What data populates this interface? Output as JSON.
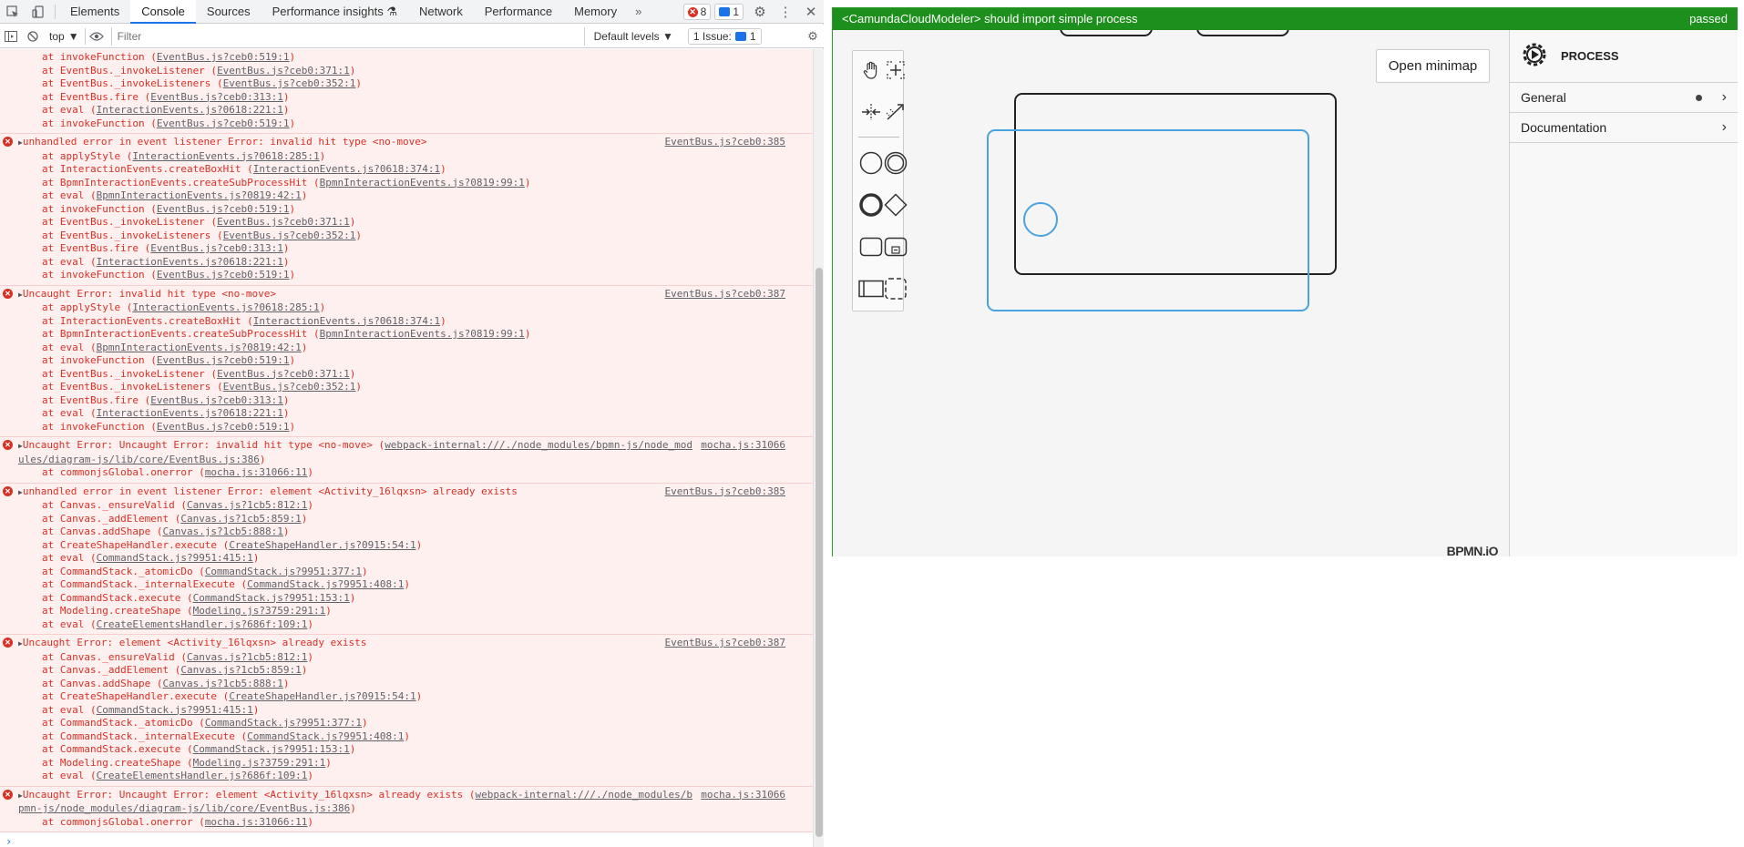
{
  "devtools": {
    "tabs": [
      "Elements",
      "Console",
      "Sources",
      "Performance insights",
      "Network",
      "Performance",
      "Memory"
    ],
    "more_tabs": "»",
    "error_count": "8",
    "message_count": "1",
    "context": "top",
    "filter_placeholder": "Filter",
    "levels": "Default levels",
    "issues": "1 Issue:",
    "issues_count": "1"
  },
  "console": {
    "partial": [
      {
        "text": "at invokeFunction (",
        "link": "EventBus.js?ceb0:519:1",
        "end": ")"
      },
      {
        "text": "at EventBus._invokeListener (",
        "link": "EventBus.js?ceb0:371:1",
        "end": ")"
      },
      {
        "text": "at EventBus._invokeListeners (",
        "link": "EventBus.js?ceb0:352:1",
        "end": ")"
      },
      {
        "text": "at EventBus.fire (",
        "link": "EventBus.js?ceb0:313:1",
        "end": ")"
      },
      {
        "text": "at eval (",
        "link": "InteractionEvents.js?0618:221:1",
        "end": ")"
      },
      {
        "text": "at invokeFunction (",
        "link": "EventBus.js?ceb0:519:1",
        "end": ")"
      }
    ],
    "entry1": {
      "head": "unhandled error in event listener Error: invalid hit type <no-move>",
      "src": "EventBus.js?ceb0:385",
      "lines": [
        {
          "text": "at applyStyle (",
          "link": "InteractionEvents.js?0618:285:1",
          "end": ")"
        },
        {
          "text": "at InteractionEvents.createBoxHit (",
          "link": "InteractionEvents.js?0618:374:1",
          "end": ")"
        },
        {
          "text": "at BpmnInteractionEvents.createSubProcessHit (",
          "link": "BpmnInteractionEvents.js?0819:99:1",
          "end": ")"
        },
        {
          "text": "at eval (",
          "link": "BpmnInteractionEvents.js?0819:42:1",
          "end": ")"
        },
        {
          "text": "at invokeFunction (",
          "link": "EventBus.js?ceb0:519:1",
          "end": ")"
        },
        {
          "text": "at EventBus._invokeListener (",
          "link": "EventBus.js?ceb0:371:1",
          "end": ")"
        },
        {
          "text": "at EventBus._invokeListeners (",
          "link": "EventBus.js?ceb0:352:1",
          "end": ")"
        },
        {
          "text": "at EventBus.fire (",
          "link": "EventBus.js?ceb0:313:1",
          "end": ")"
        },
        {
          "text": "at eval (",
          "link": "InteractionEvents.js?0618:221:1",
          "end": ")"
        },
        {
          "text": "at invokeFunction (",
          "link": "EventBus.js?ceb0:519:1",
          "end": ")"
        }
      ]
    },
    "entry2": {
      "head": "Uncaught Error: invalid hit type <no-move>",
      "src": "EventBus.js?ceb0:387",
      "lines": [
        {
          "text": "at applyStyle (",
          "link": "InteractionEvents.js?0618:285:1",
          "end": ")"
        },
        {
          "text": "at InteractionEvents.createBoxHit (",
          "link": "InteractionEvents.js?0618:374:1",
          "end": ")"
        },
        {
          "text": "at BpmnInteractionEvents.createSubProcessHit (",
          "link": "BpmnInteractionEvents.js?0819:99:1",
          "end": ")"
        },
        {
          "text": "at eval (",
          "link": "BpmnInteractionEvents.js?0819:42:1",
          "end": ")"
        },
        {
          "text": "at invokeFunction (",
          "link": "EventBus.js?ceb0:519:1",
          "end": ")"
        },
        {
          "text": "at EventBus._invokeListener (",
          "link": "EventBus.js?ceb0:371:1",
          "end": ")"
        },
        {
          "text": "at EventBus._invokeListeners (",
          "link": "EventBus.js?ceb0:352:1",
          "end": ")"
        },
        {
          "text": "at EventBus.fire (",
          "link": "EventBus.js?ceb0:313:1",
          "end": ")"
        },
        {
          "text": "at eval (",
          "link": "InteractionEvents.js?0618:221:1",
          "end": ")"
        },
        {
          "text": "at invokeFunction (",
          "link": "EventBus.js?ceb0:519:1",
          "end": ")"
        }
      ]
    },
    "entry3": {
      "head": "Uncaught Error: Uncaught Error: invalid hit type <no-move> (",
      "head_link": "webpack-internal:///./node_modules/bpmn-js/node_mod",
      "head_link2": "ules/diagram-js/lib/core/EventBus.js:386",
      "head_end": ")",
      "src": "mocha.js:31066",
      "lines": [
        {
          "text": "at commonjsGlobal.onerror (",
          "link": "mocha.js:31066:11",
          "end": ")"
        }
      ]
    },
    "entry4": {
      "head": "unhandled error in event listener Error: element <Activity_16lqxsn> already exists",
      "src": "EventBus.js?ceb0:385",
      "lines": [
        {
          "text": "at Canvas._ensureValid (",
          "link": "Canvas.js?1cb5:812:1",
          "end": ")"
        },
        {
          "text": "at Canvas._addElement (",
          "link": "Canvas.js?1cb5:859:1",
          "end": ")"
        },
        {
          "text": "at Canvas.addShape (",
          "link": "Canvas.js?1cb5:888:1",
          "end": ")"
        },
        {
          "text": "at CreateShapeHandler.execute (",
          "link": "CreateShapeHandler.js?0915:54:1",
          "end": ")"
        },
        {
          "text": "at eval (",
          "link": "CommandStack.js?9951:415:1",
          "end": ")"
        },
        {
          "text": "at CommandStack._atomicDo (",
          "link": "CommandStack.js?9951:377:1",
          "end": ")"
        },
        {
          "text": "at CommandStack._internalExecute (",
          "link": "CommandStack.js?9951:408:1",
          "end": ")"
        },
        {
          "text": "at CommandStack.execute (",
          "link": "CommandStack.js?9951:153:1",
          "end": ")"
        },
        {
          "text": "at Modeling.createShape (",
          "link": "Modeling.js?3759:291:1",
          "end": ")"
        },
        {
          "text": "at eval (",
          "link": "CreateElementsHandler.js?686f:109:1",
          "end": ")"
        }
      ]
    },
    "entry5": {
      "head": "Uncaught Error: element <Activity_16lqxsn> already exists",
      "src": "EventBus.js?ceb0:387",
      "lines": [
        {
          "text": "at Canvas._ensureValid (",
          "link": "Canvas.js?1cb5:812:1",
          "end": ")"
        },
        {
          "text": "at Canvas._addElement (",
          "link": "Canvas.js?1cb5:859:1",
          "end": ")"
        },
        {
          "text": "at Canvas.addShape (",
          "link": "Canvas.js?1cb5:888:1",
          "end": ")"
        },
        {
          "text": "at CreateShapeHandler.execute (",
          "link": "CreateShapeHandler.js?0915:54:1",
          "end": ")"
        },
        {
          "text": "at eval (",
          "link": "CommandStack.js?9951:415:1",
          "end": ")"
        },
        {
          "text": "at CommandStack._atomicDo (",
          "link": "CommandStack.js?9951:377:1",
          "end": ")"
        },
        {
          "text": "at CommandStack._internalExecute (",
          "link": "CommandStack.js?9951:408:1",
          "end": ")"
        },
        {
          "text": "at CommandStack.execute (",
          "link": "CommandStack.js?9951:153:1",
          "end": ")"
        },
        {
          "text": "at Modeling.createShape (",
          "link": "Modeling.js?3759:291:1",
          "end": ")"
        },
        {
          "text": "at eval (",
          "link": "CreateElementsHandler.js?686f:109:1",
          "end": ")"
        }
      ]
    },
    "entry6": {
      "head": "Uncaught Error: Uncaught Error: element <Activity_16lqxsn> already exists (",
      "head_link": "webpack-internal:///./node_modules/b",
      "head_link2": "pmn-js/node_modules/diagram-js/lib/core/EventBus.js:386",
      "head_end": ")",
      "src": "mocha.js:31066",
      "lines": [
        {
          "text": "at commonjsGlobal.onerror (",
          "link": "mocha.js:31066:11",
          "end": ")"
        }
      ]
    },
    "prompt": "›"
  },
  "test": {
    "title": "<CamundaCloudModeler> should import simple process",
    "status": "passed",
    "minimap_label": "Open minimap",
    "logo": "BPMN.iO",
    "properties": {
      "header": "PROCESS",
      "groups": [
        "General",
        "Documentation"
      ]
    }
  },
  "colors": {
    "pass_green": "#1d8f1d",
    "error_red": "#d93025",
    "selection_blue": "#4aa3df"
  }
}
